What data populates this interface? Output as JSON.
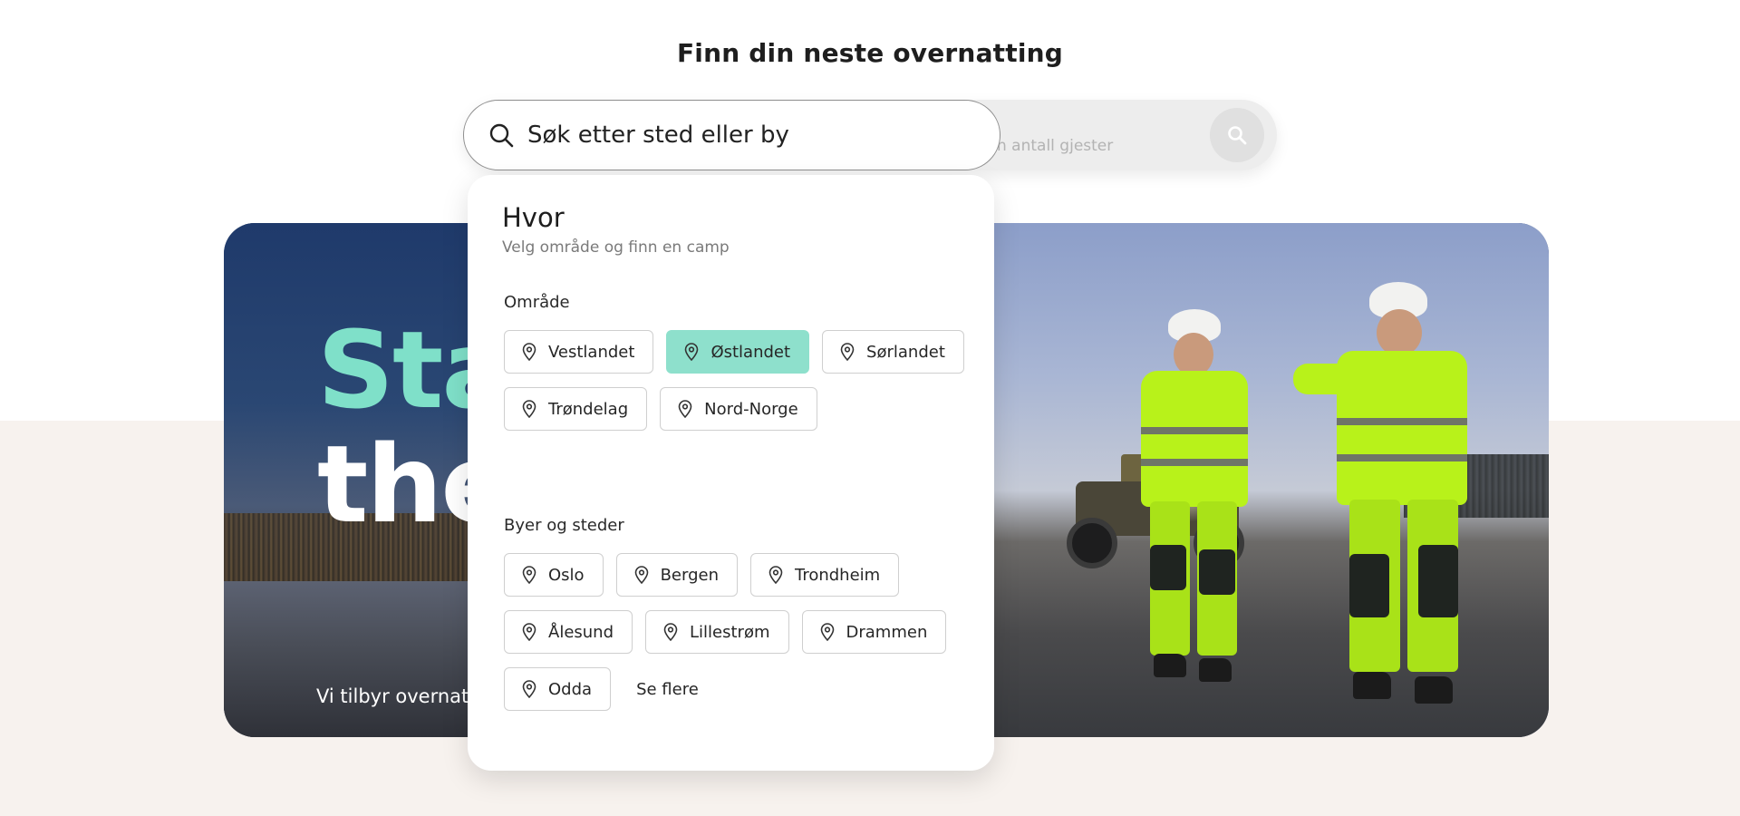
{
  "page": {
    "title": "Finn din neste overnatting"
  },
  "search": {
    "field_text": "Søk etter sted eller by",
    "guests_text": "n antall gjester",
    "search_button_icon": "search-icon"
  },
  "hero": {
    "headline_line1": "Sta",
    "headline_line2": "the",
    "subtitle": "Vi tilbyr overnatt",
    "accent_color": "#7fe0c9"
  },
  "dropdown": {
    "title": "Hvor",
    "subtitle": "Velg område og finn en camp",
    "areas_label": "Område",
    "areas": [
      {
        "label": "Vestlandet",
        "active": false
      },
      {
        "label": "Østlandet",
        "active": true
      },
      {
        "label": "Sørlandet",
        "active": false
      },
      {
        "label": "Trøndelag",
        "active": false
      },
      {
        "label": "Nord-Norge",
        "active": false
      }
    ],
    "cities_label": "Byer og steder",
    "cities": [
      {
        "label": "Oslo"
      },
      {
        "label": "Bergen"
      },
      {
        "label": "Trondheim"
      },
      {
        "label": "Ålesund"
      },
      {
        "label": "Lillestrøm"
      },
      {
        "label": "Drammen"
      },
      {
        "label": "Odda"
      }
    ],
    "see_more": "Se flere",
    "active_chip_color": "#8ee0cc",
    "chip_icon": "location-pin-icon"
  }
}
